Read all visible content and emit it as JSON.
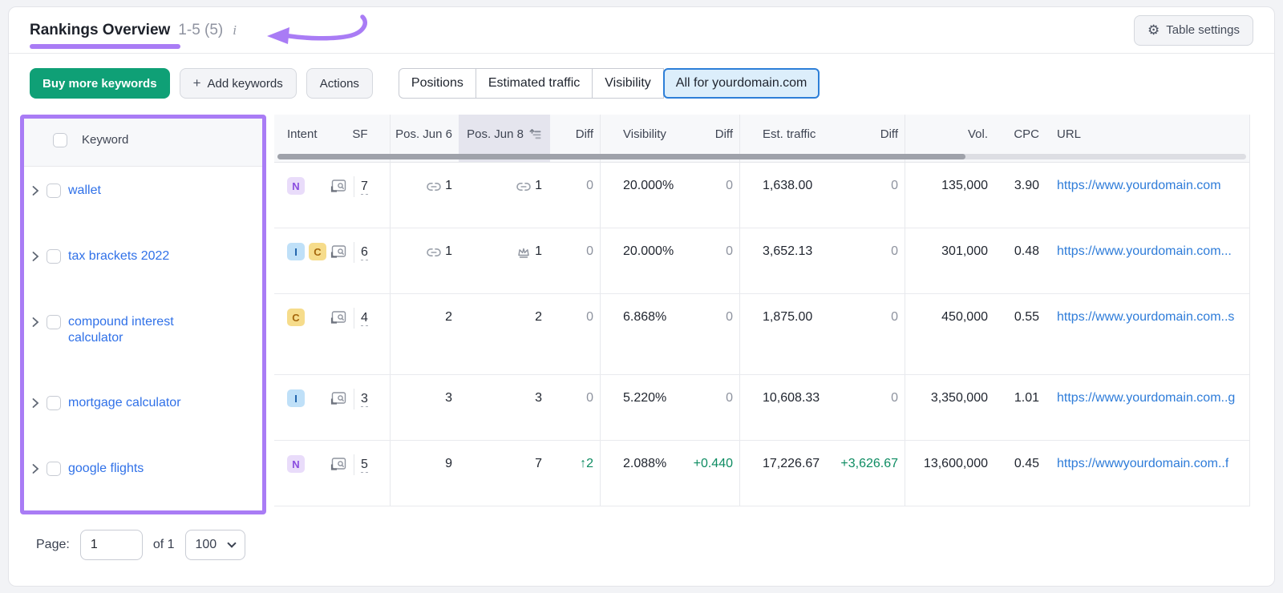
{
  "header": {
    "title": "Rankings Overview",
    "range": "1-5 (5)",
    "info_icon": "i",
    "table_settings_label": "Table settings"
  },
  "toolbar": {
    "buy_label": "Buy more keywords",
    "add_label": "Add keywords",
    "actions_label": "Actions",
    "segments": [
      "Positions",
      "Estimated traffic",
      "Visibility",
      "All for yourdomain.com"
    ],
    "selected_segment": "All for yourdomain.com"
  },
  "table": {
    "columns": [
      "Keyword",
      "Intent",
      "SF",
      "Pos. Jun 6",
      "Pos. Jun 8",
      "Diff",
      "Visibility",
      "Diff",
      "Est. traffic",
      "Diff",
      "Vol.",
      "CPC",
      "URL"
    ],
    "sorted_column": "Pos. Jun 8",
    "rows": [
      {
        "keyword": "wallet",
        "intents": [
          "N"
        ],
        "sf": "7",
        "pos_jun6": "1",
        "pos_jun6_icon": "link",
        "pos_jun8": "1",
        "pos_jun8_icon": "link",
        "diff": "0",
        "visibility": "20.000%",
        "vis_diff": "0",
        "est_traffic": "1,638.00",
        "traffic_diff": "0",
        "volume": "135,000",
        "cpc": "3.90",
        "url": "https://www.yourdomain.com"
      },
      {
        "keyword": "tax brackets 2022",
        "intents": [
          "I",
          "C"
        ],
        "sf": "6",
        "pos_jun6": "1",
        "pos_jun6_icon": "link",
        "pos_jun8": "1",
        "pos_jun8_icon": "crown",
        "diff": "0",
        "visibility": "20.000%",
        "vis_diff": "0",
        "est_traffic": "3,652.13",
        "traffic_diff": "0",
        "volume": "301,000",
        "cpc": "0.48",
        "url": "https://www.yourdomain.com..."
      },
      {
        "keyword": "compound interest calculator",
        "intents": [
          "C"
        ],
        "sf": "4",
        "pos_jun6": "2",
        "pos_jun6_icon": "",
        "pos_jun8": "2",
        "pos_jun8_icon": "",
        "diff": "0",
        "visibility": "6.868%",
        "vis_diff": "0",
        "est_traffic": "1,875.00",
        "traffic_diff": "0",
        "volume": "450,000",
        "cpc": "0.55",
        "url": "https://www.yourdomain.com..s"
      },
      {
        "keyword": "mortgage calculator",
        "intents": [
          "I"
        ],
        "sf": "3",
        "pos_jun6": "3",
        "pos_jun6_icon": "",
        "pos_jun8": "3",
        "pos_jun8_icon": "",
        "diff": "0",
        "visibility": "5.220%",
        "vis_diff": "0",
        "est_traffic": "10,608.33",
        "traffic_diff": "0",
        "volume": "3,350,000",
        "cpc": "1.01",
        "url": "https://www.yourdomain.com..g"
      },
      {
        "keyword": "google flights",
        "intents": [
          "N"
        ],
        "sf": "5",
        "pos_jun6": "9",
        "pos_jun6_icon": "",
        "pos_jun8": "7",
        "pos_jun8_icon": "",
        "diff": "↑2",
        "diff_positive": true,
        "visibility": "2.088%",
        "vis_diff": "+0.440",
        "vis_diff_positive": true,
        "est_traffic": "17,226.67",
        "traffic_diff": "+3,626.67",
        "traffic_diff_positive": true,
        "volume": "13,600,000",
        "cpc": "0.45",
        "url": "https://wwwyourdomain.com..f"
      }
    ]
  },
  "footer": {
    "page_label": "Page:",
    "page_value": "1",
    "of_label": "of 1",
    "per_page": "100"
  },
  "colors": {
    "annotation_purple": "#A97CF5",
    "primary_green": "#0FA076",
    "positive_green": "#0E8C62",
    "link_blue": "#2E7CD9",
    "keyword_blue": "#3071E8",
    "selected_segment_border": "#2D7FD8",
    "selected_segment_bg": "#DCEEFB",
    "badge_n_bg": "#E9DCFA",
    "badge_i_bg": "#BFE0F8",
    "badge_c_bg": "#F6DC8B",
    "header_bg": "#F7F8FA",
    "sorted_col_bg": "#E5E5EE"
  }
}
